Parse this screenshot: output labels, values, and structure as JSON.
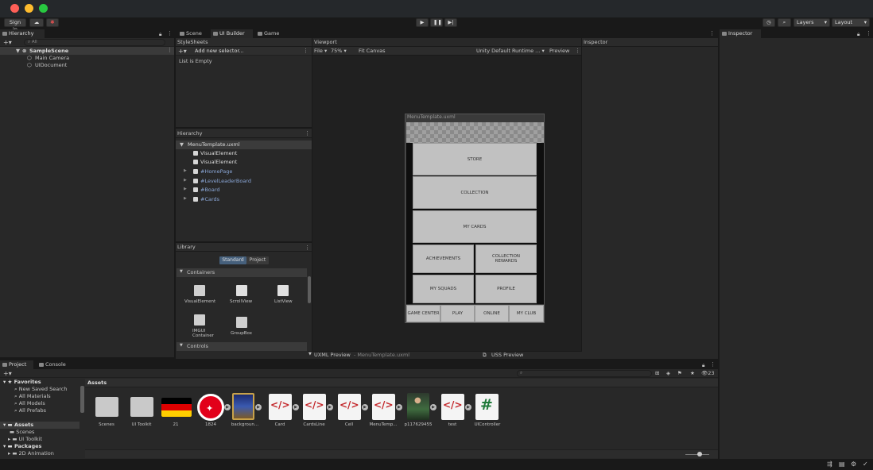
{
  "toolbar": {
    "sign_in": "Sign in",
    "layers": "Layers",
    "layout": "Layout"
  },
  "hierarchy": {
    "tab": "Hierarchy",
    "search_placeholder": "All",
    "scene": "SampleScene",
    "items": [
      "Main Camera",
      "UIDocument"
    ]
  },
  "center_tabs": {
    "scene": "Scene",
    "ui_builder": "UI Builder",
    "game": "Game"
  },
  "stylesheets": {
    "title": "StyleSheets",
    "add_selector": "Add new selector...",
    "empty": "List is Empty"
  },
  "builder_hierarchy": {
    "title": "Hierarchy",
    "root": "MenuTemplate.uxml",
    "items": [
      "VisualElement",
      "VisualElement",
      "#HomePage",
      "#LevelLeaderBoard",
      "#Board",
      "#Cards"
    ]
  },
  "library": {
    "title": "Library",
    "tab_standard": "Standard",
    "tab_project": "Project",
    "section_containers": "Containers",
    "items": [
      "VisualElement",
      "ScrollView",
      "ListView",
      "IMGUI Container",
      "GroupBox"
    ],
    "section_controls": "Controls"
  },
  "viewport": {
    "title": "Viewport",
    "file": "File",
    "zoom": "75%",
    "fit": "Fit Canvas",
    "theme": "Unity Default Runtime ...",
    "preview": "Preview",
    "canvas_title": "MenuTemplate.uxml"
  },
  "canvas_buttons": {
    "store": "STORE",
    "collection": "COLLECTION",
    "my_cards": "MY CARDS",
    "achievements": "ACHIEVEMENTS",
    "collection_rewards": "COLLECTION REWARDS",
    "my_squads": "MY SQUADS",
    "profile": "PROFILE",
    "game_center": "GAME CENTER",
    "play": "PLAY",
    "online": "ONLINE",
    "my_club": "MY CLUB"
  },
  "uxml_preview": {
    "label": "UXML Preview",
    "file": "- MenuTemplate.uxml"
  },
  "uss_preview": "USS Preview",
  "inspector": {
    "builder_title": "Inspector",
    "tab": "Inspector"
  },
  "project": {
    "tab_project": "Project",
    "tab_console": "Console",
    "hidden_count": "23",
    "favorites": "Favorites",
    "fav_items": [
      "New Saved Search",
      "All Materials",
      "All Models",
      "All Prefabs"
    ],
    "assets": "Assets",
    "asset_tree": [
      "Scenes",
      "UI Toolkit"
    ],
    "packages": "Packages",
    "package_items": [
      "2D Animation"
    ],
    "assets_header": "Assets",
    "asset_items": [
      "Scenes",
      "UI Toolkit",
      "21",
      "1824",
      "backgroun...",
      "Card",
      "CardsLine",
      "Cell",
      "MenuTemp...",
      "p117629455",
      "test",
      "UIController"
    ]
  }
}
